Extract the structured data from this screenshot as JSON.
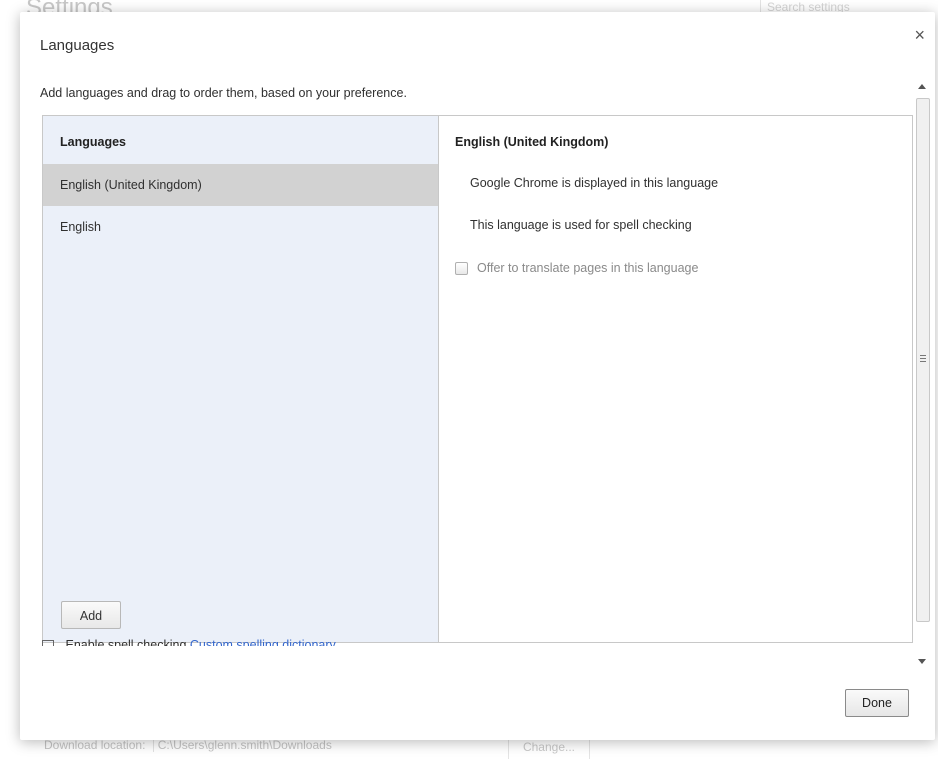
{
  "background": {
    "page_title": "Settings",
    "search_placeholder": "Search settings",
    "download_label": "Download location:",
    "download_path": "C:\\Users\\glenn.smith\\Downloads",
    "change_button": "Change..."
  },
  "dialog": {
    "title": "Languages",
    "close_icon": "×",
    "instructions": "Add languages and drag to order them, based on your preference.",
    "list_header": "Languages",
    "languages": [
      {
        "label": "English (United Kingdom)",
        "selected": true
      },
      {
        "label": "English",
        "selected": false
      }
    ],
    "add_button": "Add",
    "details": {
      "title": "English (United Kingdom)",
      "display_line": "Google Chrome is displayed in this language",
      "spell_line": "This language is used for spell checking",
      "translate_checkbox_label": "Offer to translate pages in this language",
      "translate_checked": false
    },
    "cutoff_row": {
      "label": "Enable spell checking",
      "link": "Custom spelling dictionary"
    },
    "done_button": "Done"
  },
  "colors": {
    "list_background": "#ebf0f9",
    "selected_background": "#d2d2d2",
    "link": "#3366cc"
  }
}
